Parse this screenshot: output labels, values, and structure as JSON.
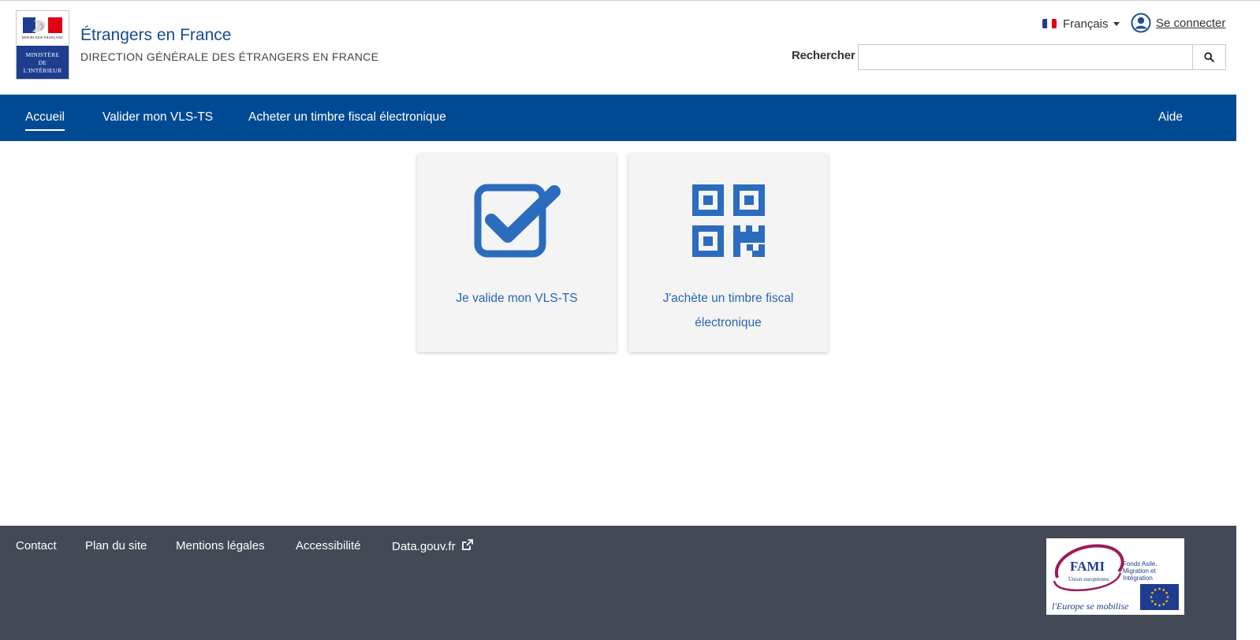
{
  "header": {
    "logo": {
      "republic_text": "RÉPUBLIQUE FRANÇAISE",
      "ministry_lines": [
        "MINISTÈRE",
        "DE",
        "L'INTÉRIEUR"
      ]
    },
    "site_title": "Étrangers en France",
    "site_subtitle": "DIRECTION GÉNÉRALE DES ÉTRANGERS EN FRANCE",
    "language": {
      "selected": "Français",
      "icon": "french-flag-icon"
    },
    "login": {
      "label": "Se connecter",
      "icon": "user-circle-icon"
    },
    "search": {
      "label": "Rechercher",
      "value": "",
      "placeholder": "",
      "icon": "search-icon"
    }
  },
  "nav": {
    "items": [
      {
        "label": "Accueil",
        "active": true
      },
      {
        "label": "Valider mon VLS-TS",
        "active": false
      },
      {
        "label": "Acheter un timbre fiscal électronique",
        "active": false
      }
    ],
    "help_label": "Aide"
  },
  "cards": [
    {
      "label": "Je valide mon VLS-TS",
      "icon": "checkbox-checked-icon"
    },
    {
      "label_lines": [
        "J'achète un timbre fiscal",
        "électronique"
      ],
      "icon": "qr-code-icon"
    }
  ],
  "footer": {
    "links": [
      "Contact",
      "Plan du site",
      "Mentions légales",
      "Accessibilité",
      "Data.gouv.fr"
    ],
    "external_icon": "external-link-icon",
    "fami": {
      "name": "FAMI",
      "description_lines": [
        "Fonds Asile,",
        "Migration et Intégration"
      ],
      "union": "Union européenne",
      "slogan": "l'Europe se mobilise"
    }
  },
  "colors": {
    "nav_bg": "#004a93",
    "brand_blue": "#174a8c",
    "card_icon": "#2b6cbf",
    "card_text": "#2966b3",
    "footer_bg": "#434a56"
  }
}
